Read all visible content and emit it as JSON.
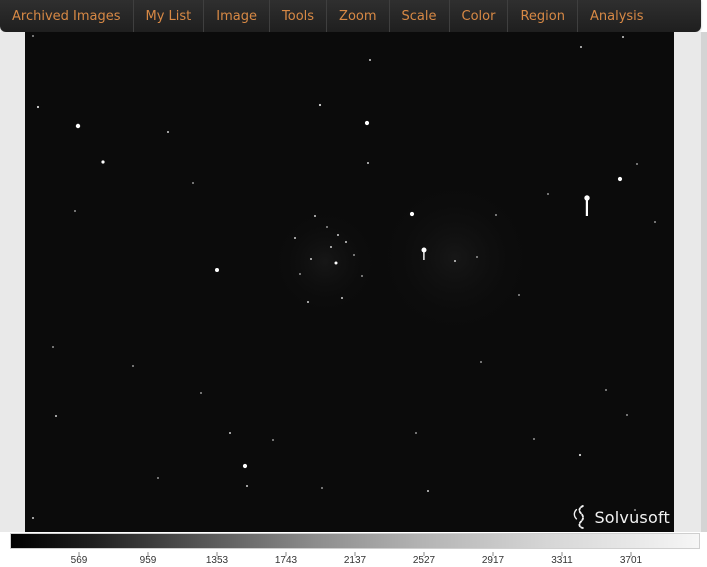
{
  "menu": {
    "items": [
      {
        "label": "Archived Images",
        "icon": "archive-icon"
      },
      {
        "label": "My List",
        "icon": "list-icon"
      },
      {
        "label": "Image",
        "icon": "image-icon"
      },
      {
        "label": "Tools",
        "icon": "tools-icon"
      },
      {
        "label": "Zoom",
        "icon": "zoom-icon"
      },
      {
        "label": "Scale",
        "icon": "scale-icon"
      },
      {
        "label": "Color",
        "icon": "color-icon"
      },
      {
        "label": "Region",
        "icon": "region-icon"
      },
      {
        "label": "Analysis",
        "icon": "analysis-icon"
      }
    ]
  },
  "watermark": {
    "text": "Solvusoft",
    "icon": "solvusoft-logo-icon"
  },
  "colorbar": {
    "labels": [
      "569",
      "959",
      "1353",
      "1743",
      "2137",
      "2527",
      "2917",
      "3311",
      "3701"
    ],
    "accent": "#d88945",
    "background": "#0b0b0b"
  }
}
